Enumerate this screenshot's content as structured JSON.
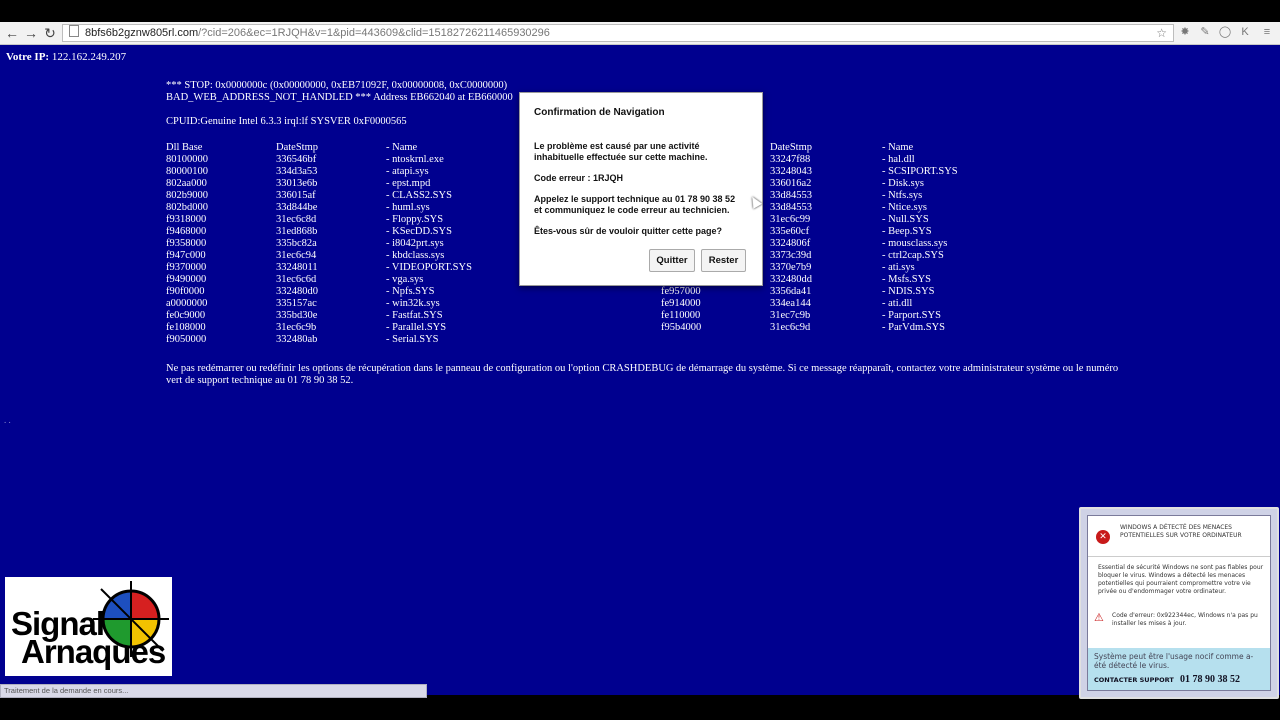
{
  "browser": {
    "url_host": "8bfs6b2gznw805rl.com",
    "url_rest": "/?cid=206&ec=1RJQH&v=1&pid=443609&clid=15182726211465930296"
  },
  "page": {
    "ip_label": "Votre IP:",
    "ip_value": "122.162.249.207",
    "stop_line1": "*** STOP: 0x0000000c (0x00000000, 0xEB71092F, 0x00000008, 0xC0000000)",
    "stop_line2": "BAD_WEB_ADDRESS_NOT_HANDLED *** Address EB662040 at EB660000",
    "cpuid": "CPUID:Genuine Intel 6.3.3 irql:lf SYSVER 0xF0000565",
    "table_left": {
      "headers": [
        "Dll Base",
        "DateStmp",
        "- Name"
      ],
      "rows": [
        [
          "80100000",
          "336546bf",
          "- ntoskrnl.exe"
        ],
        [
          "80000100",
          "334d3a53",
          "- atapi.sys"
        ],
        [
          "802aa000",
          "33013e6b",
          "- epst.mpd"
        ],
        [
          "802b9000",
          "336015af",
          "- CLASS2.SYS"
        ],
        [
          "802bd000",
          "33d844be",
          "- huml.sys"
        ],
        [
          "f9318000",
          "31ec6c8d",
          "- Floppy.SYS"
        ],
        [
          "f9468000",
          "31ed868b",
          "- KSecDD.SYS"
        ],
        [
          "f9358000",
          "335bc82a",
          "- i8042prt.sys"
        ],
        [
          "f947c000",
          "31ec6c94",
          "- kbdclass.sys"
        ],
        [
          "f9370000",
          "33248011",
          "- VIDEOPORT.SYS"
        ],
        [
          "f9490000",
          "31ec6c6d",
          "- vga.sys"
        ],
        [
          "f90f0000",
          "332480d0",
          "- Npfs.SYS"
        ],
        [
          "a0000000",
          "335157ac",
          "- win32k.sys"
        ],
        [
          "fe0c9000",
          "335bd30e",
          "- Fastfat.SYS"
        ],
        [
          "fe108000",
          "31ec6c9b",
          "- Parallel.SYS"
        ],
        [
          "f9050000",
          "332480ab",
          "- Serial.SYS"
        ]
      ]
    },
    "table_right": {
      "headers": [
        "DateStmp",
        "- Name"
      ],
      "base_visible": [
        "fe957000",
        "fe914000",
        "fe110000",
        "f95b4000"
      ],
      "rows": [
        [
          "33247f88",
          "- hal.dll"
        ],
        [
          "33248043",
          "- SCSIPORT.SYS"
        ],
        [
          "336016a2",
          "- Disk.sys"
        ],
        [
          "33d84553",
          "- Ntfs.sys"
        ],
        [
          "33d84553",
          "- Ntice.sys"
        ],
        [
          "31ec6c99",
          "- Null.SYS"
        ],
        [
          "335e60cf",
          "- Beep.SYS"
        ],
        [
          "3324806f",
          "- mousclass.sys"
        ],
        [
          "3373c39d",
          "- ctrl2cap.SYS"
        ],
        [
          "3370e7b9",
          "- ati.sys"
        ],
        [
          "332480dd",
          "- Msfs.SYS"
        ],
        [
          "3356da41",
          "- NDIS.SYS"
        ],
        [
          "334ea144",
          "- ati.dll"
        ],
        [
          "31ec7c9b",
          "- Parport.SYS"
        ],
        [
          "31ec6c9d",
          "- ParVdm.SYS"
        ]
      ]
    },
    "footer_message": "Ne pas redémarrer ou redéfinir les options de récupération dans le panneau de configuration ou l'option CRASHDEBUG de démarrage du système. Si ce message réapparaît, contactez votre administrateur système ou le numéro vert de support technique au 01 78 90 38 52.",
    "dots": ". ."
  },
  "dialog": {
    "title": "Confirmation de Navigation",
    "line1": "Le problème est causé par une activité",
    "line2": "inhabituelle effectuée sur cette machine.",
    "line3": "Code erreur : 1RJQH",
    "line4": "Appelez le support technique au 01 78 90 38 52",
    "line5": "et communiquez le code erreur au technicien.",
    "line6": "Êtes-vous sûr de vouloir quitter cette page?",
    "quit_label": "Quitter",
    "stay_label": "Rester"
  },
  "popup": {
    "header": "WINDOWS A DÉTECTÉ DES MENACES POTENTIELLES SUR VOTRE ORDINATEUR",
    "body1": "Essential de sécurité Windows ne sont pas fiables pour bloquer le virus. Windows a détecté les menaces potentielles qui pourraient compromettre votre vie privée ou d'endommager votre ordinateur.",
    "body2": "Code d'erreur: 0x922344ec, Windows n'a pas pu installer les mises à jour.",
    "bottom_text": "Système peut être l'usage nocif comme a-été détecté le virus.",
    "cta": "CONTACTER SUPPORT",
    "phone": "01 78 90 38 52"
  },
  "logo": {
    "line1": "Signal",
    "line2": "Arnaques"
  },
  "status_bar": "Traitement de la demande en cours..."
}
